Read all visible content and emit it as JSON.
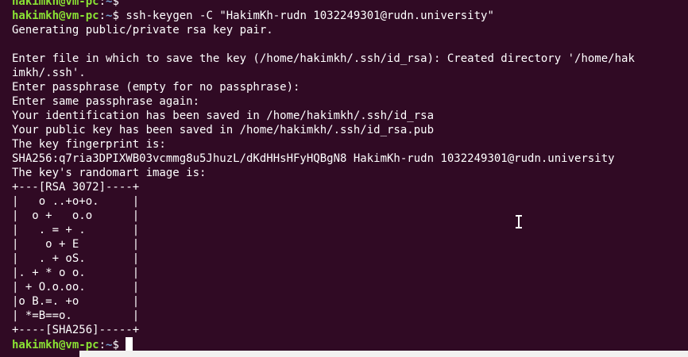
{
  "prompt": {
    "user_host": "hakimkh@vm-pc",
    "path": "~",
    "symbol": "$ "
  },
  "command": "ssh-keygen -C \"HakimKh-rudn 1032249301@rudn.university\"",
  "output": [
    "Generating public/private rsa key pair.",
    "",
    "Enter file in which to save the key (/home/hakimkh/.ssh/id_rsa): Created directory '/home/hak",
    "imkh/.ssh'.",
    "Enter passphrase (empty for no passphrase):",
    "Enter same passphrase again:",
    "Your identification has been saved in /home/hakimkh/.ssh/id_rsa",
    "Your public key has been saved in /home/hakimkh/.ssh/id_rsa.pub",
    "The key fingerprint is:",
    "SHA256:q7ria3DPIXWB03vcmmg8u5JhuzL/dKdHHsHFyHQBgN8 HakimKh-rudn 1032249301@rudn.university",
    "The key's randomart image is:",
    "+---[RSA 3072]----+",
    "|   o ..+o+o.     |",
    "|  o +   o.o      |",
    "|   . = + .       |",
    "|    o + E        |",
    "|   . + oS.       |",
    "|. + * o o.       |",
    "| + O.o.oo.       |",
    "|o B.=. +o        |",
    "| *=B==o.         |",
    "+----[SHA256]-----+"
  ],
  "colors": {
    "background": "#300a24",
    "prompt_user": "#8ae234",
    "prompt_path": "#729fcf",
    "text": "#ffffff"
  }
}
